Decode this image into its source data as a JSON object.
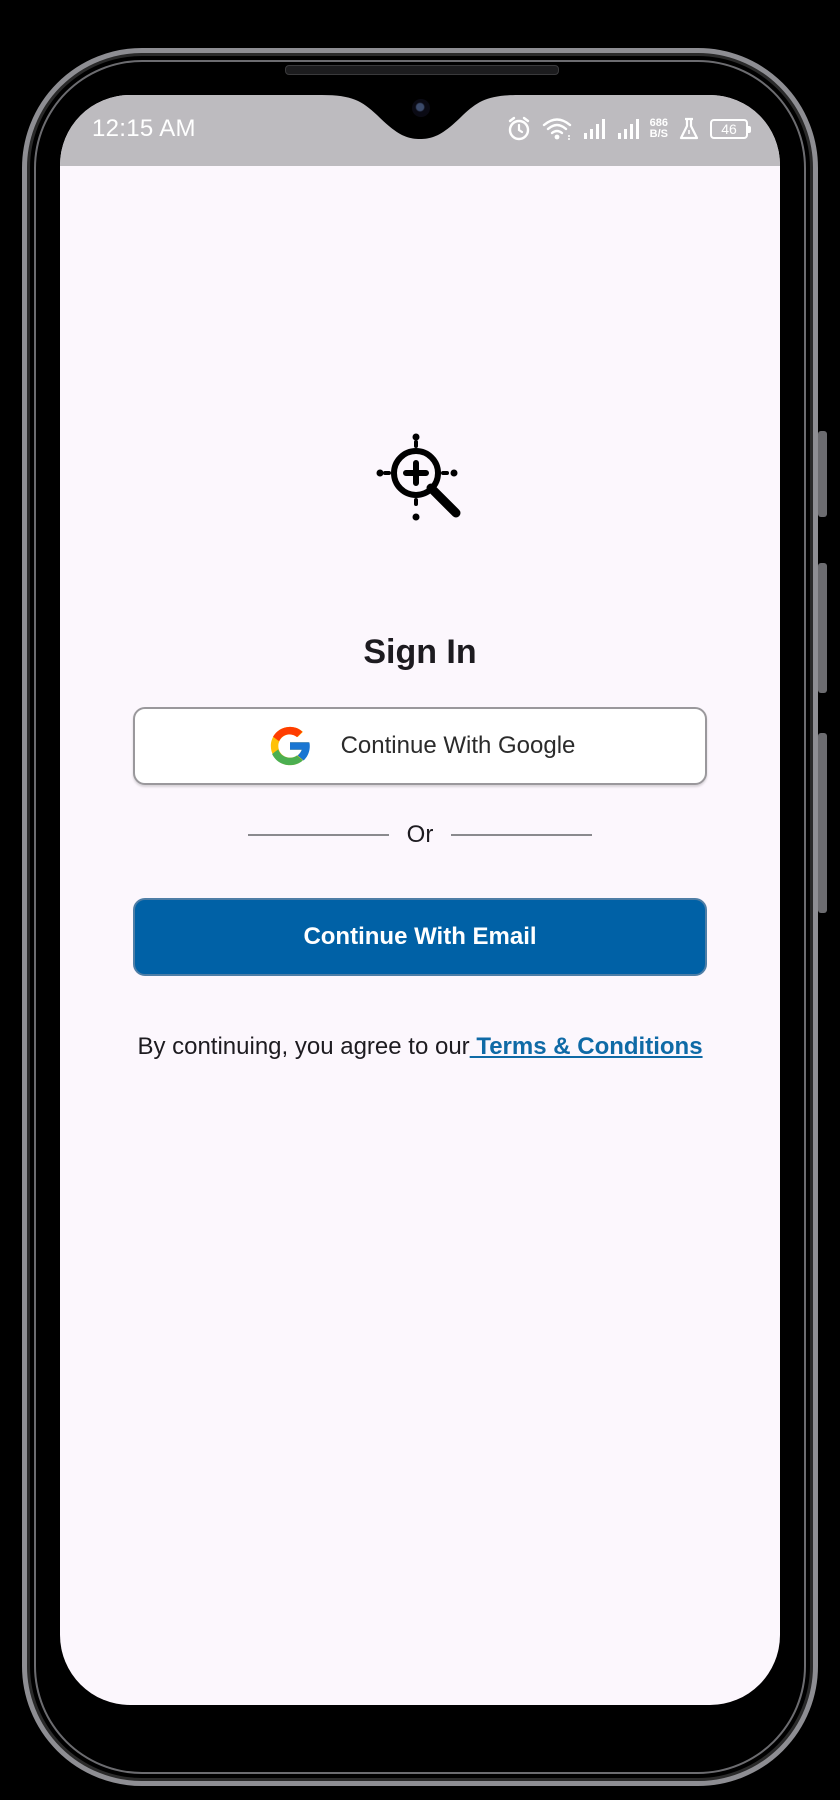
{
  "status_bar": {
    "time": "12:15 AM",
    "net_speed_value": "686",
    "net_speed_unit": "B/S",
    "battery_level": "46",
    "icons": [
      "alarm-icon",
      "wifi-icon",
      "signal-icon",
      "signal-icon",
      "flask-icon",
      "battery-icon"
    ]
  },
  "screen": {
    "logo_icon": "magnifier-plus-icon",
    "title": "Sign In",
    "google_button_label": "Continue With Google",
    "divider_text": "Or",
    "email_button_label": "Continue With Email",
    "terms_prefix": "By continuing, you agree to our",
    "terms_link": " Terms & Conditions"
  },
  "colors": {
    "background": "#fcf7fd",
    "status_bar": "#bdbbbf",
    "primary_button": "#0061a6",
    "link": "#0f6aa6",
    "text": "#1d1b20"
  }
}
